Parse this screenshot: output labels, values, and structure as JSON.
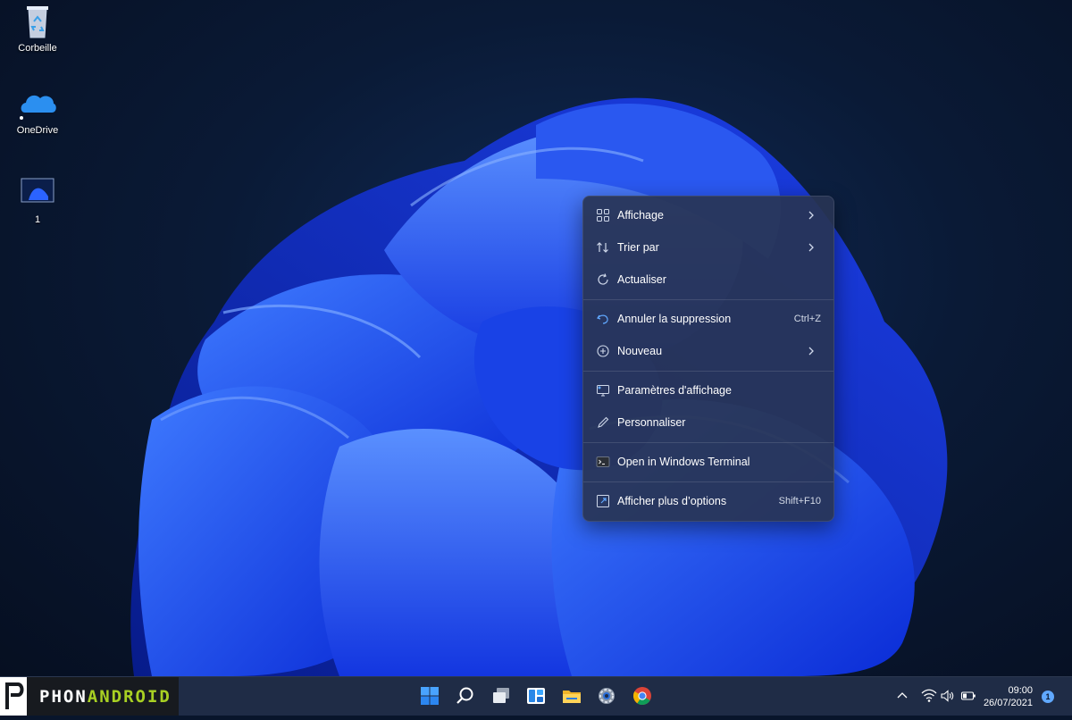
{
  "desktop": {
    "icons": [
      {
        "label": "Corbeille",
        "icon": "recycle-bin-icon"
      },
      {
        "label": "OneDrive",
        "icon": "onedrive-cloud-icon"
      },
      {
        "label": "1",
        "icon": "image-file-icon"
      }
    ]
  },
  "context_menu": {
    "items": [
      {
        "label": "Affichage",
        "icon": "grid-view-icon",
        "submenu": true
      },
      {
        "label": "Trier par",
        "icon": "sort-icon",
        "submenu": true
      },
      {
        "label": "Actualiser",
        "icon": "refresh-icon"
      },
      {
        "label": "Annuler la suppression",
        "icon": "undo-icon",
        "shortcut": "Ctrl+Z"
      },
      {
        "label": "Nouveau",
        "icon": "plus-circle-icon",
        "submenu": true
      },
      {
        "label": "Paramètres d'affichage",
        "icon": "display-settings-icon"
      },
      {
        "label": "Personnaliser",
        "icon": "pen-icon"
      },
      {
        "label": "Open in Windows Terminal",
        "icon": "terminal-icon"
      },
      {
        "label": "Afficher plus d’options",
        "icon": "more-options-icon",
        "shortcut": "Shift+F10"
      }
    ]
  },
  "taskbar": {
    "branding_part1": "PHON",
    "branding_part2": "ANDROID",
    "apps": [
      "start-icon",
      "search-icon",
      "task-view-icon",
      "widgets-icon",
      "file-explorer-icon",
      "settings-icon",
      "chrome-icon"
    ],
    "tray_icons": [
      "chevron-up-icon",
      "wifi-icon",
      "volume-icon",
      "battery-icon"
    ],
    "time": "09:00",
    "date": "26/07/2021",
    "notification_count": "1"
  },
  "colors": {
    "accent": "#2b63ff",
    "menu_bg": "#283454",
    "taskbar_bg": "#1f2c46",
    "brand_green": "#a8d023"
  }
}
